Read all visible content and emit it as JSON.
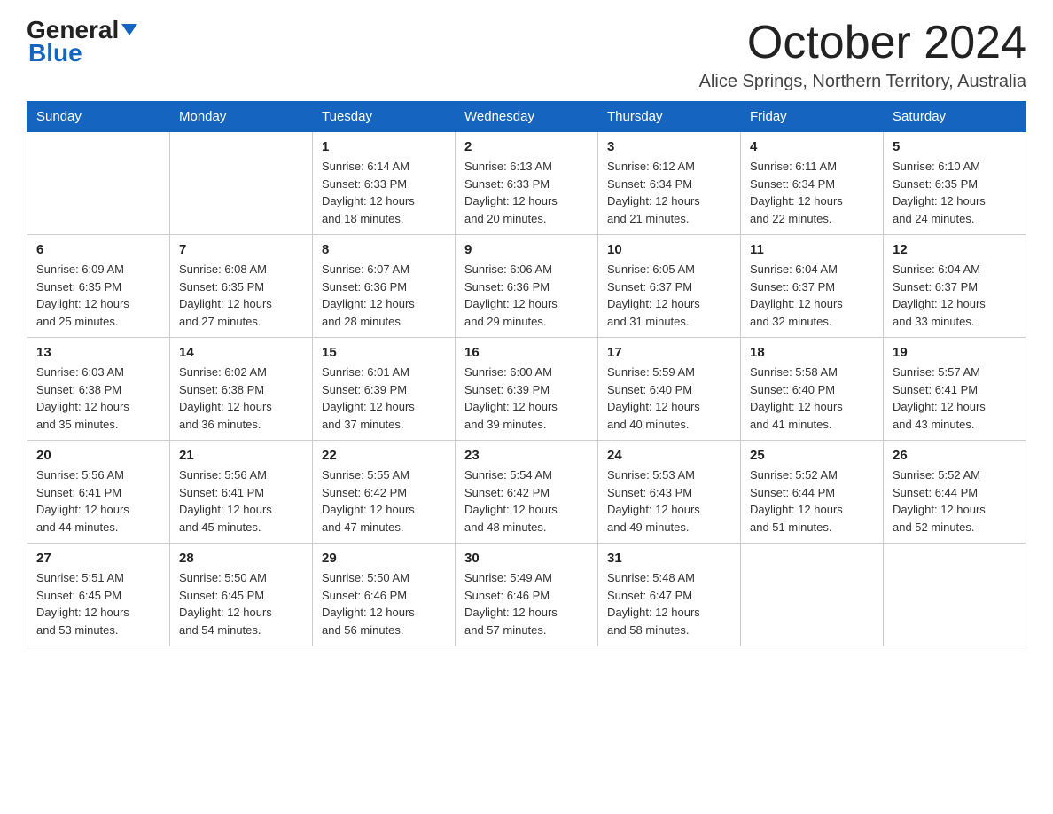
{
  "logo": {
    "general": "General",
    "blue": "Blue"
  },
  "header": {
    "month_title": "October 2024",
    "location": "Alice Springs, Northern Territory, Australia"
  },
  "weekdays": [
    "Sunday",
    "Monday",
    "Tuesday",
    "Wednesday",
    "Thursday",
    "Friday",
    "Saturday"
  ],
  "weeks": [
    [
      {
        "day": "",
        "info": ""
      },
      {
        "day": "",
        "info": ""
      },
      {
        "day": "1",
        "info": "Sunrise: 6:14 AM\nSunset: 6:33 PM\nDaylight: 12 hours\nand 18 minutes."
      },
      {
        "day": "2",
        "info": "Sunrise: 6:13 AM\nSunset: 6:33 PM\nDaylight: 12 hours\nand 20 minutes."
      },
      {
        "day": "3",
        "info": "Sunrise: 6:12 AM\nSunset: 6:34 PM\nDaylight: 12 hours\nand 21 minutes."
      },
      {
        "day": "4",
        "info": "Sunrise: 6:11 AM\nSunset: 6:34 PM\nDaylight: 12 hours\nand 22 minutes."
      },
      {
        "day": "5",
        "info": "Sunrise: 6:10 AM\nSunset: 6:35 PM\nDaylight: 12 hours\nand 24 minutes."
      }
    ],
    [
      {
        "day": "6",
        "info": "Sunrise: 6:09 AM\nSunset: 6:35 PM\nDaylight: 12 hours\nand 25 minutes."
      },
      {
        "day": "7",
        "info": "Sunrise: 6:08 AM\nSunset: 6:35 PM\nDaylight: 12 hours\nand 27 minutes."
      },
      {
        "day": "8",
        "info": "Sunrise: 6:07 AM\nSunset: 6:36 PM\nDaylight: 12 hours\nand 28 minutes."
      },
      {
        "day": "9",
        "info": "Sunrise: 6:06 AM\nSunset: 6:36 PM\nDaylight: 12 hours\nand 29 minutes."
      },
      {
        "day": "10",
        "info": "Sunrise: 6:05 AM\nSunset: 6:37 PM\nDaylight: 12 hours\nand 31 minutes."
      },
      {
        "day": "11",
        "info": "Sunrise: 6:04 AM\nSunset: 6:37 PM\nDaylight: 12 hours\nand 32 minutes."
      },
      {
        "day": "12",
        "info": "Sunrise: 6:04 AM\nSunset: 6:37 PM\nDaylight: 12 hours\nand 33 minutes."
      }
    ],
    [
      {
        "day": "13",
        "info": "Sunrise: 6:03 AM\nSunset: 6:38 PM\nDaylight: 12 hours\nand 35 minutes."
      },
      {
        "day": "14",
        "info": "Sunrise: 6:02 AM\nSunset: 6:38 PM\nDaylight: 12 hours\nand 36 minutes."
      },
      {
        "day": "15",
        "info": "Sunrise: 6:01 AM\nSunset: 6:39 PM\nDaylight: 12 hours\nand 37 minutes."
      },
      {
        "day": "16",
        "info": "Sunrise: 6:00 AM\nSunset: 6:39 PM\nDaylight: 12 hours\nand 39 minutes."
      },
      {
        "day": "17",
        "info": "Sunrise: 5:59 AM\nSunset: 6:40 PM\nDaylight: 12 hours\nand 40 minutes."
      },
      {
        "day": "18",
        "info": "Sunrise: 5:58 AM\nSunset: 6:40 PM\nDaylight: 12 hours\nand 41 minutes."
      },
      {
        "day": "19",
        "info": "Sunrise: 5:57 AM\nSunset: 6:41 PM\nDaylight: 12 hours\nand 43 minutes."
      }
    ],
    [
      {
        "day": "20",
        "info": "Sunrise: 5:56 AM\nSunset: 6:41 PM\nDaylight: 12 hours\nand 44 minutes."
      },
      {
        "day": "21",
        "info": "Sunrise: 5:56 AM\nSunset: 6:41 PM\nDaylight: 12 hours\nand 45 minutes."
      },
      {
        "day": "22",
        "info": "Sunrise: 5:55 AM\nSunset: 6:42 PM\nDaylight: 12 hours\nand 47 minutes."
      },
      {
        "day": "23",
        "info": "Sunrise: 5:54 AM\nSunset: 6:42 PM\nDaylight: 12 hours\nand 48 minutes."
      },
      {
        "day": "24",
        "info": "Sunrise: 5:53 AM\nSunset: 6:43 PM\nDaylight: 12 hours\nand 49 minutes."
      },
      {
        "day": "25",
        "info": "Sunrise: 5:52 AM\nSunset: 6:44 PM\nDaylight: 12 hours\nand 51 minutes."
      },
      {
        "day": "26",
        "info": "Sunrise: 5:52 AM\nSunset: 6:44 PM\nDaylight: 12 hours\nand 52 minutes."
      }
    ],
    [
      {
        "day": "27",
        "info": "Sunrise: 5:51 AM\nSunset: 6:45 PM\nDaylight: 12 hours\nand 53 minutes."
      },
      {
        "day": "28",
        "info": "Sunrise: 5:50 AM\nSunset: 6:45 PM\nDaylight: 12 hours\nand 54 minutes."
      },
      {
        "day": "29",
        "info": "Sunrise: 5:50 AM\nSunset: 6:46 PM\nDaylight: 12 hours\nand 56 minutes."
      },
      {
        "day": "30",
        "info": "Sunrise: 5:49 AM\nSunset: 6:46 PM\nDaylight: 12 hours\nand 57 minutes."
      },
      {
        "day": "31",
        "info": "Sunrise: 5:48 AM\nSunset: 6:47 PM\nDaylight: 12 hours\nand 58 minutes."
      },
      {
        "day": "",
        "info": ""
      },
      {
        "day": "",
        "info": ""
      }
    ]
  ]
}
